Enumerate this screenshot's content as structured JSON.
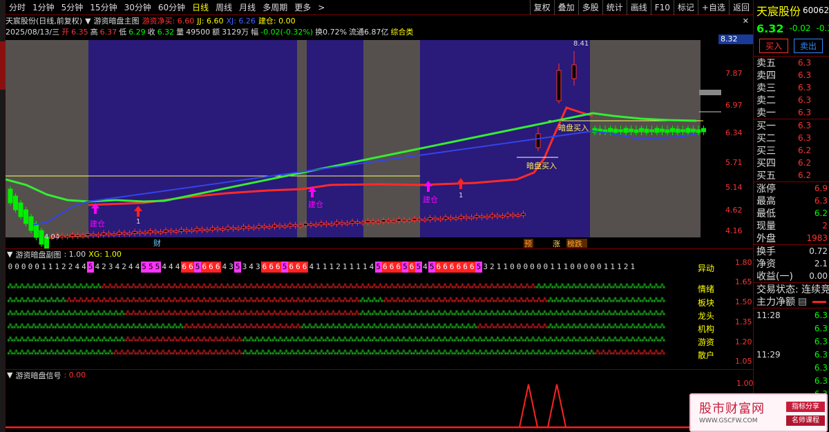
{
  "toolbar": {
    "periods": [
      "分时",
      "1分钟",
      "5分钟",
      "15分钟",
      "30分钟",
      "60分钟",
      "日线",
      "周线",
      "月线",
      "多周期",
      "更多"
    ],
    "active_period": "日线",
    "buttons": [
      "复权",
      "叠加",
      "多股",
      "统计",
      "画线",
      "F10",
      "标记",
      "+自选",
      "返回"
    ]
  },
  "header": {
    "stock_line": "天宸股份(日线,前复权)",
    "indicator_name": "游资暗盘主图",
    "yz_label": "游资净买: 6.60",
    "jj_label": "JJ: 6.60",
    "xj_label": "XJ: 6.26",
    "jc_label": "建仓: 0.00",
    "date": "2025/08/13/三",
    "open_label": "开",
    "open": "6.35",
    "high_label": "高",
    "high": "6.37",
    "low_label": "低",
    "low": "6.29",
    "close_label": "收",
    "close": "6.32",
    "vol_label": "量",
    "vol": "49500",
    "amt_label": "额",
    "amt": "3129万",
    "chg_label": "幅",
    "chg": "-0.02(-0.32%)",
    "turn": "换0.72%",
    "float": "流通6.87亿",
    "cat": "综合类"
  },
  "main_chart": {
    "price_ticks": [
      "7.87",
      "6.97",
      "6.34",
      "5.71",
      "5.14",
      "4.62",
      "4.16"
    ],
    "current_price_tag": "8.32",
    "annotation_high": "8.41",
    "annotation_low": "4.04",
    "signals": [
      "建仓",
      "1",
      "建仓",
      "建仓",
      "1"
    ],
    "dark_buy_1": "暗盘买入",
    "dark_buy_2": "暗盘买入",
    "bottom_tags": [
      "财",
      "预",
      "涨",
      "榜跌"
    ]
  },
  "sub1": {
    "title": "游资暗盘副图",
    "value": ": 1.00",
    "xg": "XG: 1.00",
    "axis": [
      "1.80",
      "1.65",
      "1.50",
      "1.35",
      "1.20",
      "1.05"
    ],
    "row_labels": [
      "异动",
      "情绪",
      "板块",
      "龙头",
      "机构",
      "游资",
      "散户"
    ],
    "digits": "0000011122445423424455544466566643534366656664111211114566656545666666532110000001110000011121"
  },
  "sub2": {
    "title": "游资暗盘信号",
    "value": ": 0.00",
    "axis": [
      "1.00"
    ]
  },
  "right_panel": {
    "name": "天宸股份",
    "code": "60062",
    "price": "6.32",
    "change": "-0.02",
    "change_pct": "-0.3",
    "buy_label": "买入",
    "sell_label": "卖出",
    "sell_book": [
      {
        "label": "卖五",
        "val": "6.3"
      },
      {
        "label": "卖四",
        "val": "6.3"
      },
      {
        "label": "卖三",
        "val": "6.3"
      },
      {
        "label": "卖二",
        "val": "6.3"
      },
      {
        "label": "卖一",
        "val": "6.3"
      }
    ],
    "buy_book": [
      {
        "label": "买一",
        "val": "6.3"
      },
      {
        "label": "买二",
        "val": "6.3"
      },
      {
        "label": "买三",
        "val": "6.2"
      },
      {
        "label": "买四",
        "val": "6.2"
      },
      {
        "label": "买五",
        "val": "6.2"
      }
    ],
    "stats1": [
      {
        "label": "涨停",
        "val": "6.9"
      },
      {
        "label": "最高",
        "val": "6.3"
      },
      {
        "label": "最低",
        "val": "6.2"
      },
      {
        "label": "现量",
        "val": "2"
      },
      {
        "label": "外盘",
        "val": "1983"
      }
    ],
    "stats2": [
      {
        "label": "换手",
        "val": "0.72"
      },
      {
        "label": "净资",
        "val": "2.1"
      },
      {
        "label": "收益(一)",
        "val": "0.00"
      }
    ],
    "trade_state": "交易状态: 连续竞",
    "main_flow": "主力净额",
    "ticks": [
      {
        "t": "11:28",
        "v": "6.3"
      },
      {
        "t": "",
        "v": "6.3"
      },
      {
        "t": "",
        "v": "6.3"
      },
      {
        "t": "11:29",
        "v": "6.3"
      },
      {
        "t": "",
        "v": "6.3"
      },
      {
        "t": "",
        "v": "6.3"
      },
      {
        "t": "",
        "v": "6.3"
      },
      {
        "t": "",
        "v": "6.3"
      }
    ]
  },
  "watermark": {
    "title": "股市财富网",
    "url": "WWW.GSCFW.COM",
    "badge1": "指标分享",
    "badge2": "名师课程"
  },
  "colors": {
    "up": "#ff3333",
    "down": "#00ff00",
    "accent": "#ffff00",
    "magenta": "#ff00ff"
  }
}
